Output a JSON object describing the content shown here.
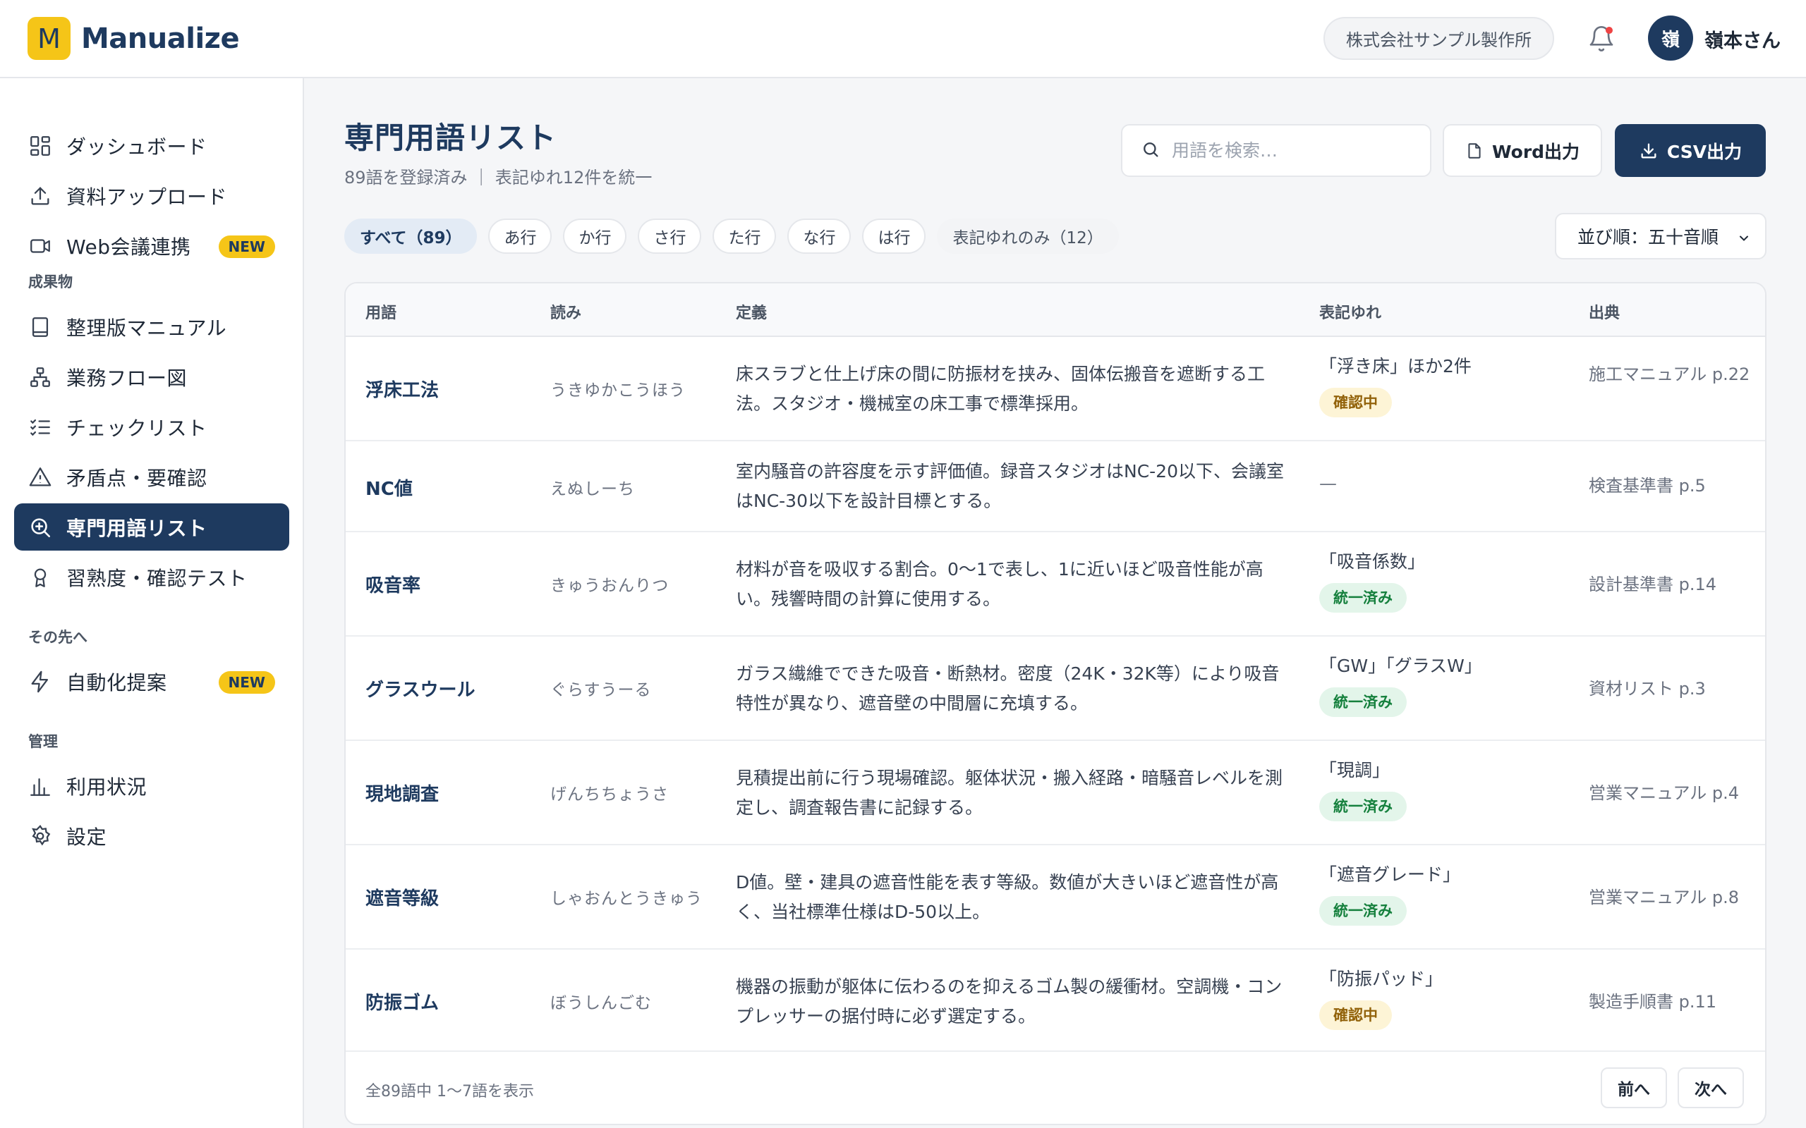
{
  "app": {
    "logo_letter": "M",
    "name": "Manualize"
  },
  "header": {
    "company": "株式会社サンプル製作所",
    "avatar_initial": "嶺",
    "user_name": "嶺本さん"
  },
  "sidebar": {
    "items": [
      {
        "label": "ダッシュボード",
        "icon": "dashboard-icon"
      },
      {
        "label": "資料アップロード",
        "icon": "upload-icon"
      },
      {
        "label": "Web会議連携",
        "icon": "video-icon",
        "badge": "NEW"
      }
    ],
    "section_outputs": "成果物",
    "outputs": [
      {
        "label": "整理版マニュアル",
        "icon": "book-icon"
      },
      {
        "label": "業務フロー図",
        "icon": "flow-icon"
      },
      {
        "label": "チェックリスト",
        "icon": "checklist-icon"
      },
      {
        "label": "矛盾点・要確認",
        "icon": "warning-icon"
      },
      {
        "label": "専門用語リスト",
        "icon": "glossary-search-icon",
        "active": true
      },
      {
        "label": "習熟度・確認テスト",
        "icon": "award-icon"
      }
    ],
    "section_future": "その先へ",
    "future": [
      {
        "label": "自動化提案",
        "icon": "bolt-icon",
        "badge": "NEW"
      }
    ],
    "section_admin": "管理",
    "admin": [
      {
        "label": "利用状況",
        "icon": "bar-chart-icon"
      },
      {
        "label": "設定",
        "icon": "gear-icon"
      }
    ]
  },
  "main": {
    "title": "専門用語リスト",
    "subtitle": "89語を登録済み ｜ 表記ゆれ12件を統一",
    "search_placeholder": "用語を検索…",
    "word_button": "Word出力",
    "csv_button": "CSV出力",
    "filters": [
      "すべて（89）",
      "あ行",
      "か行",
      "さ行",
      "た行",
      "な行",
      "は行",
      "表記ゆれのみ（12）"
    ],
    "sort": "並び順：五十音順"
  },
  "table": {
    "columns": [
      "用語",
      "読み",
      "定義",
      "表記ゆれ",
      "出典"
    ],
    "rows": [
      {
        "term": "浮床工法",
        "reading": "うきゆかこうほう",
        "definition": "床スラブと仕上げ床の間に防振材を挟み、固体伝搬音を遮断する工法。スタジオ・機械室の床工事で標準採用。",
        "variant": "「浮き床」ほか2件",
        "status": "確認中",
        "source": "施工マニュアル p.22"
      },
      {
        "term": "NC値",
        "reading": "えぬしーち",
        "definition": "室内騒音の許容度を示す評価値。録音スタジオはNC-20以下、会議室はNC-30以下を設計目標とする。",
        "variant": "—",
        "status": "",
        "source": "検査基準書 p.5"
      },
      {
        "term": "吸音率",
        "reading": "きゅうおんりつ",
        "definition": "材料が音を吸収する割合。0〜1で表し、1に近いほど吸音性能が高い。残響時間の計算に使用する。",
        "variant": "「吸音係数」",
        "status": "統一済み",
        "source": "設計基準書 p.14"
      },
      {
        "term": "グラスウール",
        "reading": "ぐらすうーる",
        "definition": "ガラス繊維でできた吸音・断熱材。密度（24K・32K等）により吸音特性が異なり、遮音壁の中間層に充填する。",
        "variant": "「GW」「グラスW」",
        "status": "統一済み",
        "source": "資材リスト p.3"
      },
      {
        "term": "現地調査",
        "reading": "げんちちょうさ",
        "definition": "見積提出前に行う現場確認。躯体状況・搬入経路・暗騒音レベルを測定し、調査報告書に記録する。",
        "variant": "「現調」",
        "status": "統一済み",
        "source": "営業マニュアル p.4"
      },
      {
        "term": "遮音等級",
        "reading": "しゃおんとうきゅう",
        "definition": "D値。壁・建具の遮音性能を表す等級。数値が大きいほど遮音性が高く、当社標準仕様はD-50以上。",
        "variant": "「遮音グレード」",
        "status": "統一済み",
        "source": "営業マニュアル p.8"
      },
      {
        "term": "防振ゴム",
        "reading": "ぼうしんごむ",
        "definition": "機器の振動が躯体に伝わるのを抑えるゴム製の緩衝材。空調機・コンプレッサーの据付時に必ず選定する。",
        "variant": "「防振パッド」",
        "status": "確認中",
        "source": "製造手順書 p.11"
      }
    ],
    "footer_info": "全89語中 1〜7語を表示",
    "prev": "前へ",
    "next": "次へ"
  },
  "colors": {
    "brand_navy": "#1e3a5f",
    "brand_yellow": "#f5c518",
    "status_confirm": "#92620a",
    "status_unified": "#15803d"
  }
}
